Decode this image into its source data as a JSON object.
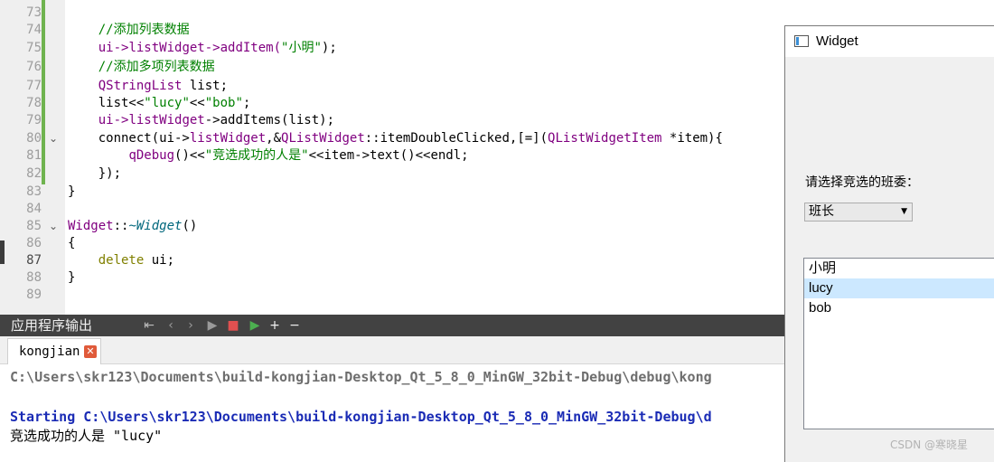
{
  "editor": {
    "line_numbers": [
      "73",
      "74",
      "75",
      "76",
      "77",
      "78",
      "79",
      "80",
      "81",
      "82",
      "83",
      "84",
      "85",
      "86",
      "87",
      "88",
      "89"
    ],
    "fold_markers": [
      "⌄",
      "⌄"
    ],
    "code": {
      "l74_comment": "//添加列表数据",
      "l75_a": "ui->",
      "l75_b": "listWidget",
      "l75_c": "->addItem(",
      "l75_str": "\"小明\"",
      "l75_d": ");",
      "l76_comment": "//添加多项列表数据",
      "l77_type": "QStringList",
      "l77_rest": " list;",
      "l78_a": "list<<",
      "l78_s1": "\"lucy\"",
      "l78_b": "<<",
      "l78_s2": "\"bob\"",
      "l78_c": ";",
      "l79_a": "ui->",
      "l79_b": "listWidget",
      "l79_c": "->addItems(list);",
      "l80_a": "connect(ui->",
      "l80_b": "listWidget",
      "l80_c": ",&",
      "l80_d": "QListWidget",
      "l80_e": "::itemDoubleClicked,[=](",
      "l80_f": "QListWidgetItem",
      "l80_g": " *item){",
      "l81_fn": "qDebug",
      "l81_a": "()<<",
      "l81_str": "\"竞选成功的人是\"",
      "l81_b": "<<item->text()<<endl;",
      "l82": "});",
      "l83": "}",
      "l85_cls": "Widget",
      "l85_a": "::",
      "l85_fn": "~Widget",
      "l85_b": "()",
      "l86": "{",
      "l87_kw": "delete",
      "l87_rest": " ui;",
      "l88": "}"
    }
  },
  "output_pane": {
    "title": "应用程序输出",
    "toolbar_icons": [
      "⇤",
      "‹",
      "›",
      "▶",
      "■",
      "▶",
      "+",
      "−"
    ],
    "tab_label": "kongjian",
    "tab_close": "✕",
    "lines": [
      "C:\\Users\\skr123\\Documents\\build-kongjian-Desktop_Qt_5_8_0_MinGW_32bit-Debug\\debug\\kong",
      "Starting C:\\Users\\skr123\\Documents\\build-kongjian-Desktop_Qt_5_8_0_MinGW_32bit-Debug\\d",
      "竞选成功的人是 \"lucy\""
    ]
  },
  "widget": {
    "title": "Widget",
    "prompt": "请选择竞选的班委：",
    "combo_value": "班长",
    "combo_arrow": "▼",
    "list_items": [
      "小明",
      "lucy",
      "bob"
    ],
    "selected_index": 1
  },
  "watermark": "CSDN @寒晓星",
  "colors": {
    "comment": "#008000",
    "keyword": "#808000",
    "type": "#800080",
    "string": "#008000",
    "output_blue": "#1a2bb5",
    "selection": "#cce8ff",
    "gutter_change_bar": "#6fb34f"
  }
}
